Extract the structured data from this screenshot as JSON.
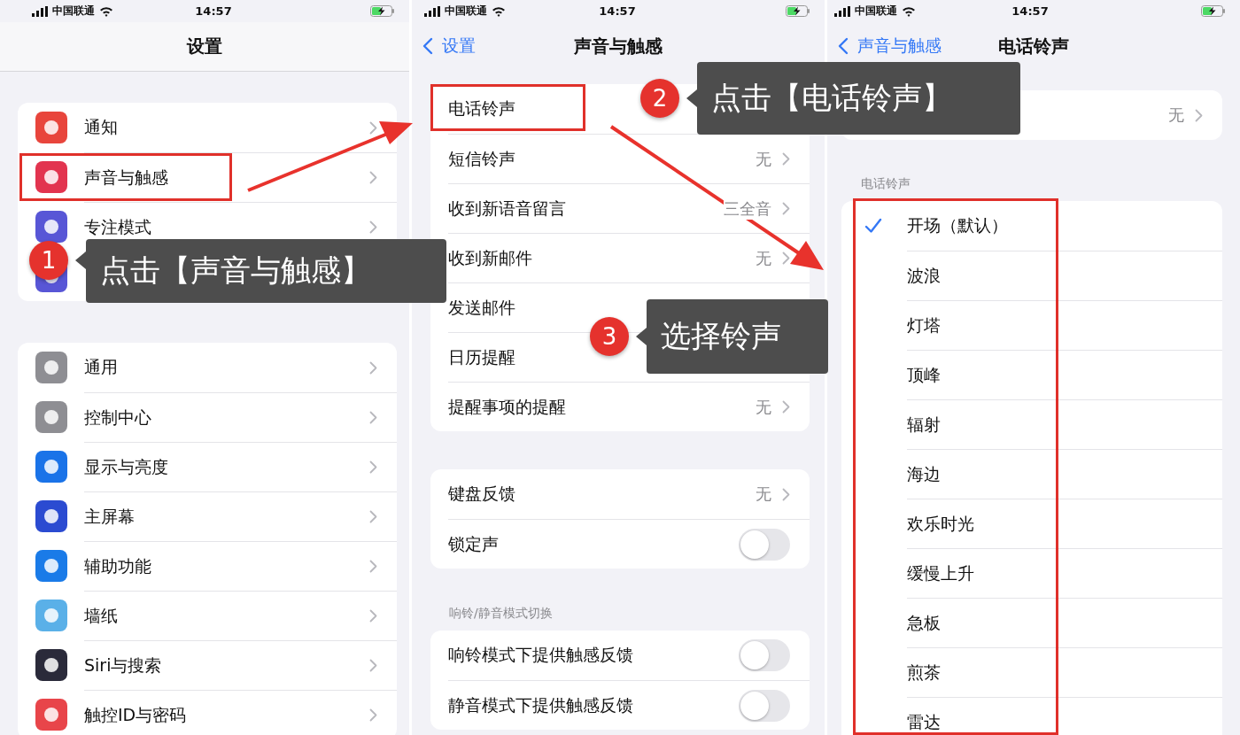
{
  "panels": [
    {
      "status_bar": {
        "carrier": "中国联通",
        "time": "14:57"
      },
      "nav": {
        "title": "设置"
      },
      "groups": [
        {
          "rows": [
            {
              "kind": "link",
              "label": "通知",
              "color": "#e8453c"
            },
            {
              "kind": "link",
              "label": "声音与触感",
              "color": "#e2344f",
              "highlighted": true
            },
            {
              "kind": "link",
              "label": "专注模式",
              "color": "#5856d6"
            },
            {
              "kind": "link",
              "color": "#5856d6"
            }
          ]
        },
        {
          "rows": [
            {
              "kind": "link",
              "label": "通用",
              "color": "#8e8e93"
            },
            {
              "kind": "link",
              "label": "控制中心",
              "color": "#8e8e93"
            },
            {
              "kind": "link",
              "label": "显示与亮度",
              "color": "#1a73e8"
            },
            {
              "kind": "link",
              "label": "主屏幕",
              "color": "#2b4bd1"
            },
            {
              "kind": "link",
              "label": "辅助功能",
              "color": "#1a7be8"
            },
            {
              "kind": "link",
              "label": "墙纸",
              "color": "#5ab0e8"
            },
            {
              "kind": "link",
              "label": "Siri与搜索",
              "color": "#2a2a3a"
            },
            {
              "kind": "link",
              "label": "触控ID与密码",
              "color": "#e8454a"
            }
          ]
        }
      ]
    },
    {
      "status_bar": {
        "carrier": "中国联通",
        "time": "14:57"
      },
      "nav": {
        "back": "设置",
        "title": "声音与触感"
      },
      "groups": [
        {
          "rows": [
            {
              "kind": "link",
              "label": "电话铃声",
              "highlighted": true
            },
            {
              "kind": "link",
              "label": "短信铃声",
              "value": "无"
            },
            {
              "kind": "link",
              "label": "收到新语音留言",
              "value": "三全音"
            },
            {
              "kind": "link",
              "label": "收到新邮件",
              "value": "无"
            },
            {
              "kind": "link",
              "label": "发送邮件"
            },
            {
              "kind": "link",
              "label": "日历提醒"
            },
            {
              "kind": "link",
              "label": "提醒事项的提醒",
              "value": "无"
            }
          ]
        },
        {
          "rows": [
            {
              "kind": "link",
              "label": "键盘反馈",
              "value": "无"
            },
            {
              "kind": "toggle",
              "label": "锁定声",
              "on": false
            }
          ]
        },
        {
          "header": "响铃/静音模式切换",
          "rows": [
            {
              "kind": "toggle",
              "label": "响铃模式下提供触感反馈",
              "on": false
            },
            {
              "kind": "toggle",
              "label": "静音模式下提供触感反馈",
              "on": false
            }
          ]
        }
      ]
    },
    {
      "status_bar": {
        "carrier": "中国联通",
        "time": "14:57"
      },
      "nav": {
        "back": "声音与触感",
        "title": "电话铃声"
      },
      "groups": [
        {
          "rows": [
            {
              "kind": "link",
              "value": "无"
            }
          ]
        },
        {
          "header": "电话铃声",
          "highlighted": true,
          "rows": [
            {
              "kind": "check",
              "label": "开场（默认）",
              "selected": true
            },
            {
              "kind": "check",
              "label": "波浪",
              "selected": false
            },
            {
              "kind": "check",
              "label": "灯塔",
              "selected": false
            },
            {
              "kind": "check",
              "label": "顶峰",
              "selected": false
            },
            {
              "kind": "check",
              "label": "辐射",
              "selected": false
            },
            {
              "kind": "check",
              "label": "海边",
              "selected": false
            },
            {
              "kind": "check",
              "label": "欢乐时光",
              "selected": false
            },
            {
              "kind": "check",
              "label": "缓慢上升",
              "selected": false
            },
            {
              "kind": "check",
              "label": "急板",
              "selected": false
            },
            {
              "kind": "check",
              "label": "煎茶",
              "selected": false
            },
            {
              "kind": "check",
              "label": "雷达",
              "selected": false
            }
          ]
        }
      ]
    }
  ],
  "annotations": [
    {
      "number": "1",
      "text": "点击【声音与触感】"
    },
    {
      "number": "2",
      "text": "点击【电话铃声】"
    },
    {
      "number": "3",
      "text": "选择铃声"
    }
  ]
}
